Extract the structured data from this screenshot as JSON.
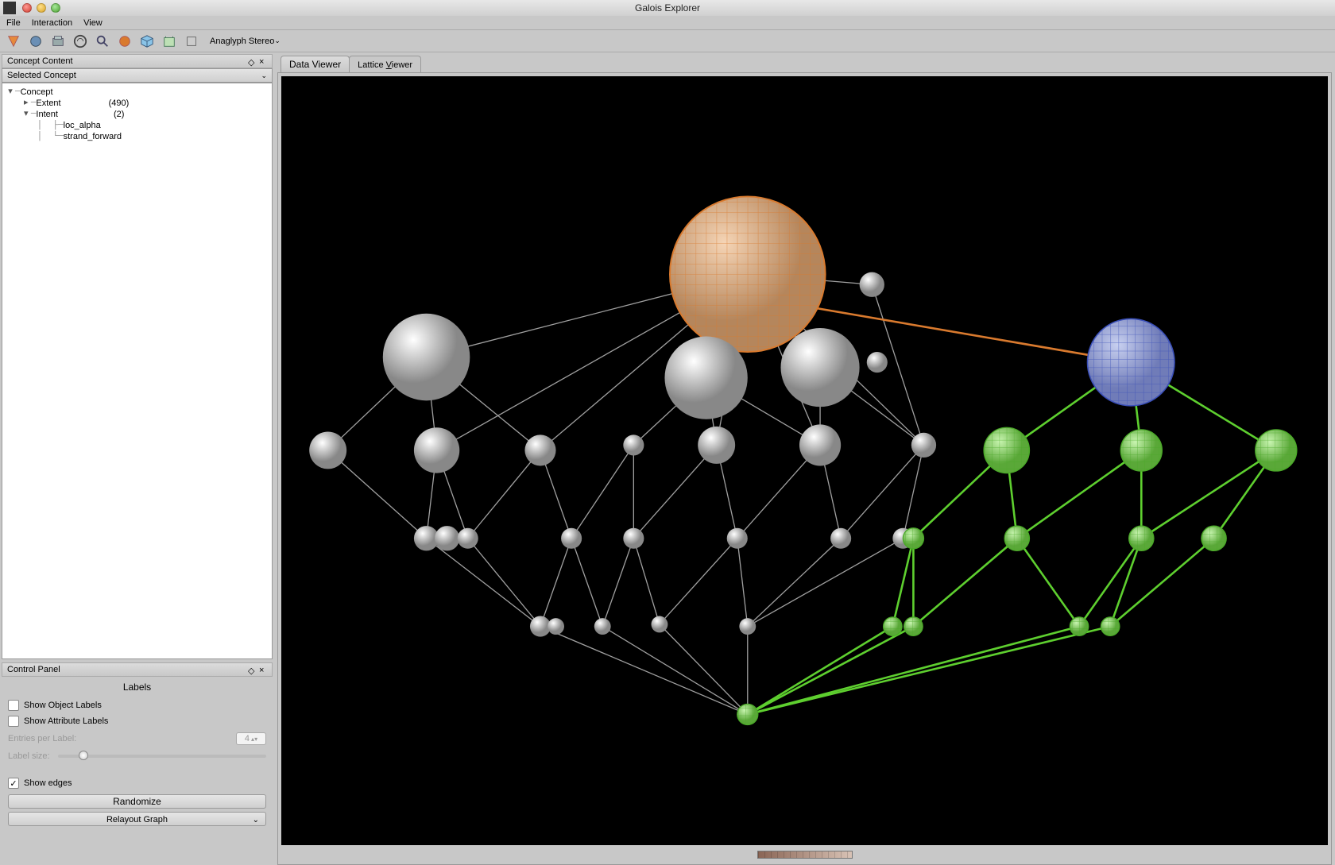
{
  "window": {
    "title": "Galois Explorer"
  },
  "menubar": {
    "file": "File",
    "interaction": "Interaction",
    "view": "View"
  },
  "toolbar": {
    "stereo_label": "Anaglyph Stereo"
  },
  "left_panel": {
    "title": "Concept Content",
    "dropdown": "Selected Concept",
    "tree": {
      "root": "Concept",
      "extent": {
        "label": "Extent",
        "count": "(490)"
      },
      "intent": {
        "label": "Intent",
        "count": "(2)",
        "items": [
          "loc_alpha",
          "strand_forward"
        ]
      }
    }
  },
  "control_panel": {
    "title": "Control Panel",
    "section": "Labels",
    "show_object_labels": "Show Object Labels",
    "show_attribute_labels": "Show Attribute Labels",
    "entries_per_label": "Entries per Label:",
    "entries_value": "4",
    "label_size": "Label size:",
    "show_edges": "Show edges",
    "randomize": "Randomize",
    "relayout": "Relayout Graph"
  },
  "tabs": {
    "data": "Data Viewer",
    "lattice_pre": "Lattice ",
    "lattice_u": "V",
    "lattice_post": "iewer"
  },
  "colors": {
    "orange": "#d97a2e",
    "blue": "#3a4fb8",
    "green": "#5ecf2f",
    "gray": "#cccccc",
    "edge_gray": "#a0a0a0"
  }
}
